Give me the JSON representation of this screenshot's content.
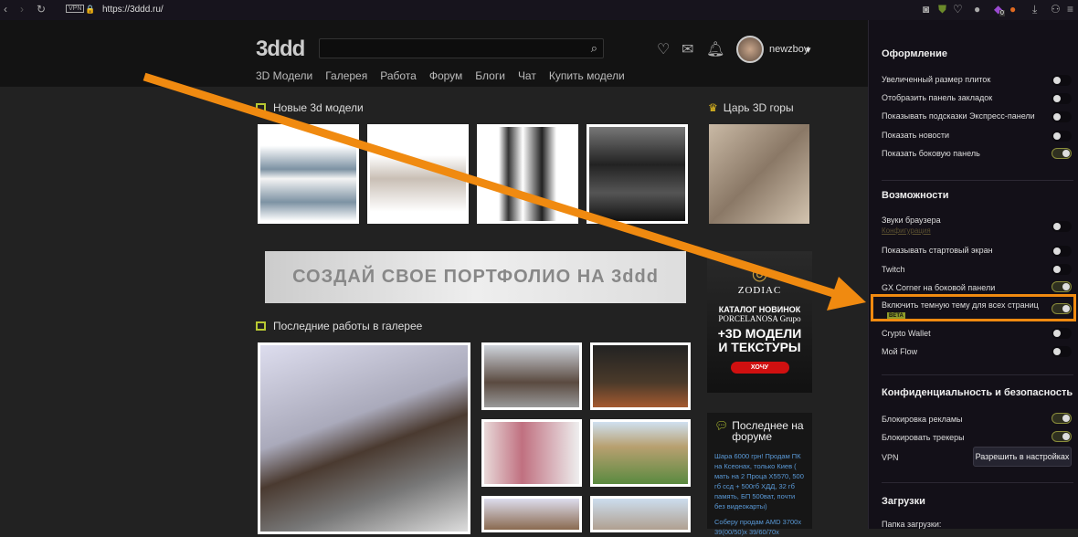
{
  "browser": {
    "url": "https://3ddd.ru/",
    "vpn_label": "VPN",
    "badge_count": "0"
  },
  "site": {
    "logo": "3ddd",
    "search_icon": "search-icon",
    "nav": [
      "3D Модели",
      "Галерея",
      "Работа",
      "Форум",
      "Блоги",
      "Чат",
      "Купить модели"
    ],
    "username": "newzboy"
  },
  "main": {
    "new_models_title": "Новые 3d модели",
    "king_title": "Царь 3D горы",
    "banner_text": "СОЗДАЙ СВОЕ ПОРТФОЛИО НА 3ddd",
    "gallery_title": "Последние работы в галерее",
    "ad": {
      "brand": "ZODIAC",
      "line1": "КАТАЛОГ НОВИНОК",
      "line2": "PORCELANOSA Grupo",
      "line3": "+3D МОДЕЛИ И ТЕКСТУРЫ",
      "cta": "ХОЧУ"
    },
    "forum": {
      "title": "Последнее на форуме",
      "post1": "Шара 6000 грн! Продам ПК на Ксеонах, только Киев ( мать на 2 Проца Х5570, 500 гб ссд + 500гб ХДД, 32 гб память, БП 500ват, почти без видеокарты)",
      "post2": "Соберу продам AMD 3700x 39(00/50)x 39/60/70x"
    }
  },
  "panel": {
    "appearance": {
      "title": "Оформление",
      "items": [
        {
          "label": "Увеличенный размер плиток",
          "on": false
        },
        {
          "label": "Отобразить панель закладок",
          "on": false
        },
        {
          "label": "Показывать подсказки Экспресс-панели",
          "on": false
        },
        {
          "label": "Показать новости",
          "on": false
        },
        {
          "label": "Показать боковую панель",
          "on": true
        }
      ]
    },
    "features": {
      "title": "Возможности",
      "sounds": "Звуки браузера",
      "sounds_link": "Конфигурация",
      "items": [
        {
          "label": "Звуки браузера",
          "on": false
        },
        {
          "label": "Показывать стартовый экран",
          "on": false
        },
        {
          "label": "Twitch",
          "on": false
        },
        {
          "label": "GX Corner на боковой панели",
          "on": true
        },
        {
          "label": "Включить темную тему для всех страниц",
          "on": true,
          "badge": "BETA"
        },
        {
          "label": "Crypto Wallet",
          "on": false
        },
        {
          "label": "Мой Flow",
          "on": false
        }
      ]
    },
    "privacy": {
      "title": "Конфиденциальность и безопасность",
      "items": [
        {
          "label": "Блокировка рекламы",
          "on": true
        },
        {
          "label": "Блокировать трекеры",
          "on": true
        }
      ],
      "vpn_label": "VPN",
      "vpn_button": "Разрешить в настройках"
    },
    "downloads": {
      "title": "Загрузки",
      "folder_label": "Папка загрузки:"
    }
  },
  "annotation": {
    "arrow_color": "#f08a10",
    "highlight_color": "#f08a10"
  }
}
